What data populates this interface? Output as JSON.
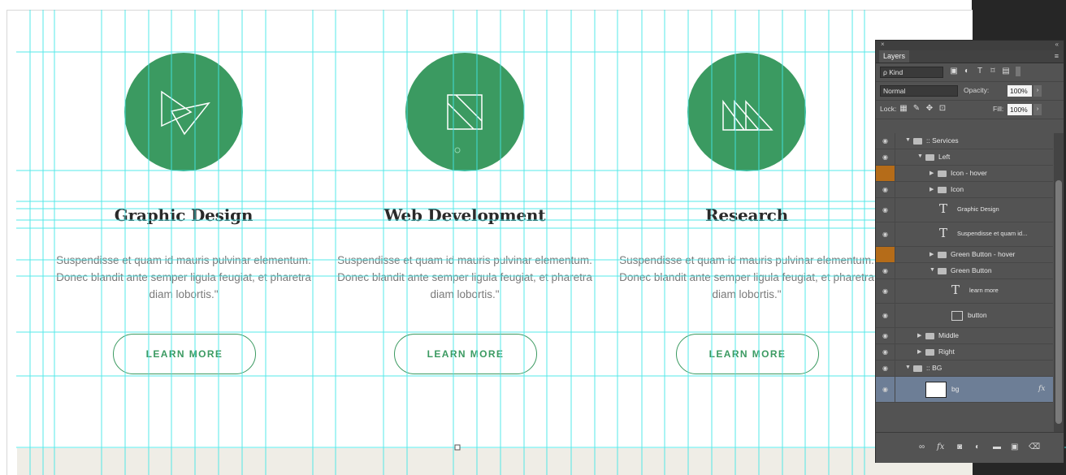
{
  "colors": {
    "accent_green": "#3b9a61",
    "guide_cyan": "#43e6e6",
    "panel_bg": "#535353",
    "selected_layer_bg": "#6d7e96",
    "hover_marker_orange": "#b56c19"
  },
  "services": [
    {
      "title": "Graphic Design",
      "description": "Suspendisse et quam id mauris pulvinar elementum. Donec blandit ante semper ligula feugiat, et pharetra diam lobortis.\"",
      "button_label": "LEARN MORE",
      "icon": "overlapping-triangles-icon"
    },
    {
      "title": "Web Development",
      "description": "Suspendisse et quam id mauris pulvinar elementum. Donec blandit ante semper ligula feugiat, et pharetra diam lobortis.\"",
      "button_label": "LEARN MORE",
      "icon": "diagonal-square-icon"
    },
    {
      "title": "Research",
      "description": "Suspendisse et quam id mauris pulvinar elementum. Donec blandit ante semper ligula feugiat, et pharetra diam lobortis.\"",
      "button_label": "LEARN MORE",
      "icon": "triple-triangles-icon"
    }
  ],
  "layers_panel": {
    "close_glyph": "×",
    "collapse_glyph": "«",
    "tab_label": "Layers",
    "menu_glyph": "≡",
    "filter_kind": "ρ Kind",
    "blend_mode": "Normal",
    "opacity_label": "Opacity:",
    "opacity_value": "100%",
    "lock_label": "Lock:",
    "fill_label": "Fill:",
    "fill_value": "100%",
    "layers": [
      {
        "name": ":: Services",
        "type": "group",
        "expanded": true,
        "indent": 0
      },
      {
        "name": "Left",
        "type": "group",
        "expanded": true,
        "indent": 1
      },
      {
        "name": "Icon - hover",
        "type": "group",
        "expanded": false,
        "indent": 2,
        "marker": "orange"
      },
      {
        "name": "Icon",
        "type": "group",
        "expanded": false,
        "indent": 2
      },
      {
        "name": "Graphic Design",
        "type": "text",
        "indent": 2
      },
      {
        "name": "Suspendisse et quam id...",
        "type": "text",
        "indent": 2
      },
      {
        "name": "Green Button - hover",
        "type": "group",
        "expanded": false,
        "indent": 2,
        "marker": "orange"
      },
      {
        "name": "Green Button",
        "type": "group",
        "expanded": true,
        "indent": 2
      },
      {
        "name": "learn more",
        "type": "text",
        "indent": 3
      },
      {
        "name": "button",
        "type": "shape",
        "indent": 3
      },
      {
        "name": "Middle",
        "type": "group",
        "expanded": false,
        "indent": 1
      },
      {
        "name": "Right",
        "type": "group",
        "expanded": false,
        "indent": 1
      },
      {
        "name": ":: BG",
        "type": "group",
        "expanded": true,
        "indent": 0
      },
      {
        "name": "bg",
        "type": "pixel",
        "indent": 1,
        "selected": true,
        "fx": "fx"
      }
    ],
    "bottom_icons": [
      "link-icon",
      "fx-icon",
      "mask-icon",
      "adjustment-icon",
      "new-group-icon",
      "new-layer-icon",
      "trash-icon"
    ]
  }
}
